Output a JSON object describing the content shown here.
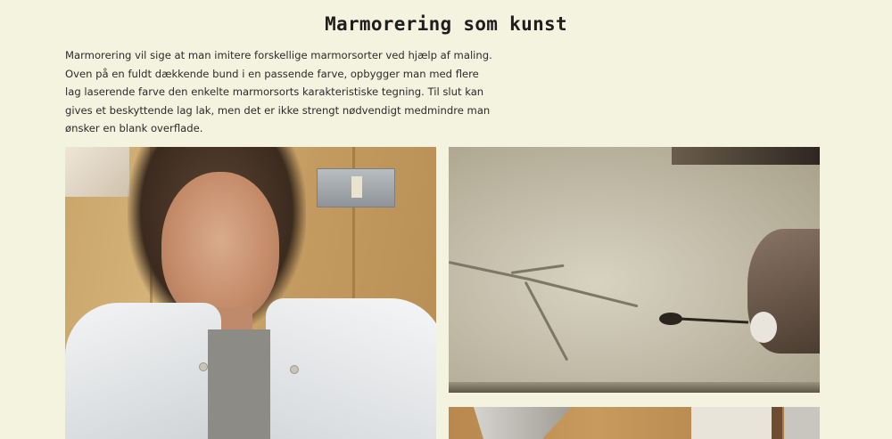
{
  "page": {
    "title": "Marmorering som kunst",
    "intro_lines": [
      "Marmorering vil sige at man imitere forskellige marmorsorter ved hjælp af maling.",
      "Oven på en fuldt dækkende bund i en passende farve, opbygger man med flere",
      "lag laserende farve den enkelte marmorsorts karakteristiske tegning. Til slut kan",
      "gives et beskyttende lag lak, men det er ikke strengt nødvendigt medmindre man",
      "ønsker en blank overflade."
    ]
  },
  "colors": {
    "background": "#f4f3df",
    "text": "#2a2a2a"
  }
}
